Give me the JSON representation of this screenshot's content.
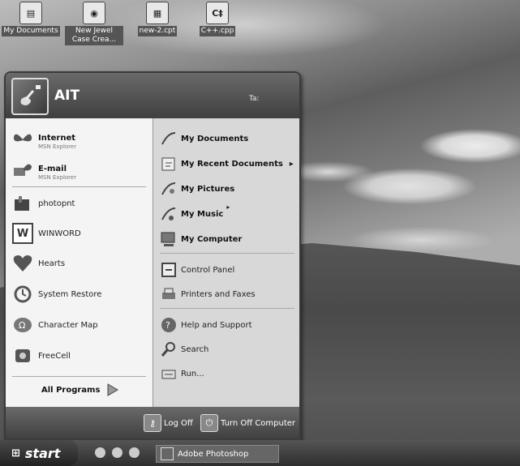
{
  "desktop": {
    "icons": [
      {
        "label": "My Documents"
      },
      {
        "label": "New Jewel Case Crea..."
      },
      {
        "label": "new-2.cpt"
      },
      {
        "label": "C++.cpp"
      }
    ]
  },
  "start_menu": {
    "user_name": "AIT",
    "header_extra": "Ta:",
    "pinned": [
      {
        "label": "Internet",
        "sub": "MSN Explorer"
      },
      {
        "label": "E-mail",
        "sub": "MSN Explorer"
      }
    ],
    "recent": [
      {
        "label": "photopnt"
      },
      {
        "label": "WINWORD"
      },
      {
        "label": "Hearts"
      },
      {
        "label": "System Restore"
      },
      {
        "label": "Character Map"
      },
      {
        "label": "FreeCell"
      }
    ],
    "all_programs": "All Programs",
    "right_primary": [
      {
        "label": "My Documents"
      },
      {
        "label": "My Recent Documents"
      },
      {
        "label": "My Pictures"
      },
      {
        "label": "My Music"
      },
      {
        "label": "My Computer"
      }
    ],
    "right_secondary": [
      {
        "label": "Control Panel"
      },
      {
        "label": "Printers and Faxes"
      },
      {
        "label": "Help and Support"
      },
      {
        "label": "Search"
      },
      {
        "label": "Run..."
      }
    ],
    "log_off": "Log Off",
    "turn_off": "Turn Off Computer"
  },
  "taskbar": {
    "start": "start",
    "task_item": "Adobe Photoshop"
  },
  "colors": {
    "header": "#4f4f4f",
    "left_panel": "#f4f4f4",
    "right_panel": "#d8d8d8"
  }
}
